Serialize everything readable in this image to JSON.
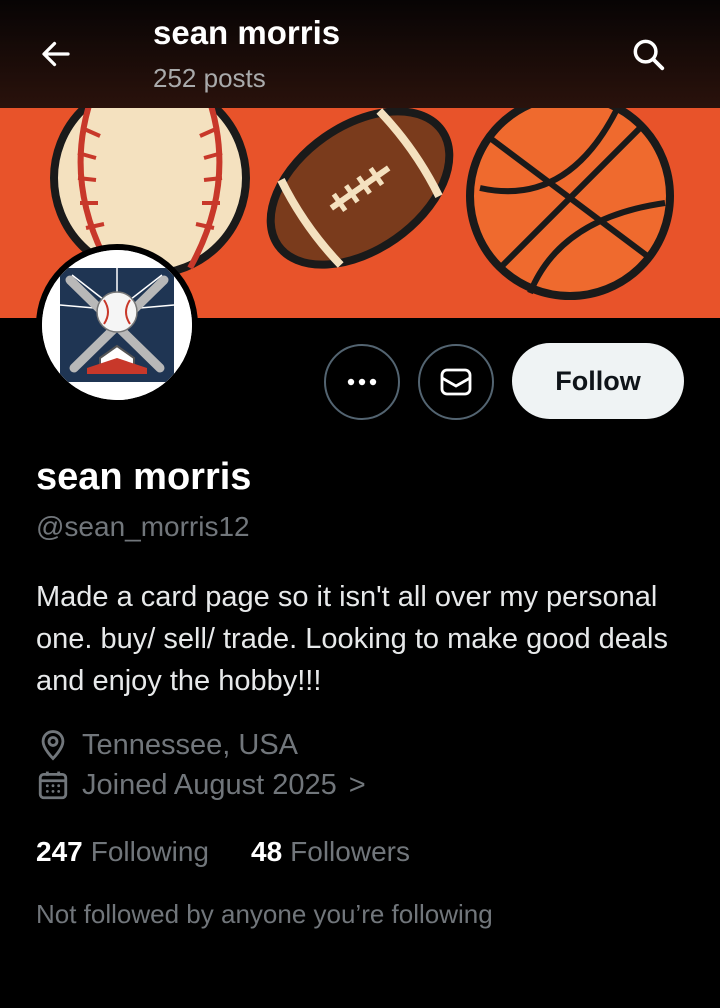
{
  "header": {
    "name": "sean morris",
    "posts": "252 posts"
  },
  "profile": {
    "display_name": "sean morris",
    "handle": "@sean_morris12",
    "bio": "Made a card page so it isn't all over my personal one. buy/ sell/ trade. Looking to make good deals and enjoy the hobby!!!",
    "location": "Tennessee, USA",
    "joined": "Joined August 2025",
    "joined_chevron": ">",
    "following_count": "247",
    "following_label": "Following",
    "followers_count": "48",
    "followers_label": "Followers",
    "not_followed_note": "Not followed by anyone you’re following"
  },
  "actions": {
    "more_icon": "more-icon",
    "message_icon": "envelope-icon",
    "follow_label": "Follow"
  },
  "colors": {
    "banner_orange": "#e8532a",
    "follow_bg": "#eff3f4",
    "muted_text": "#71767b"
  }
}
